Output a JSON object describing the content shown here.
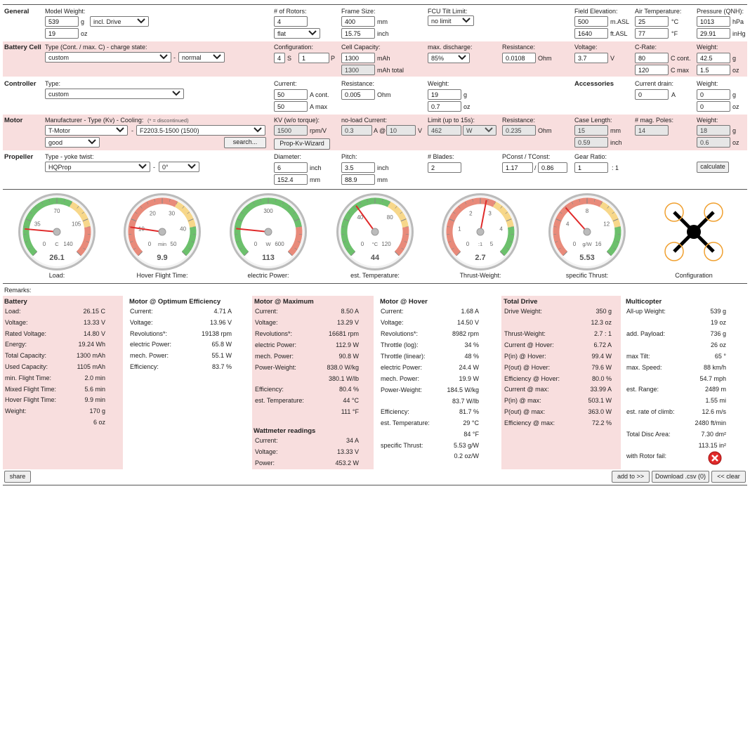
{
  "general": {
    "section": "General",
    "model_weight_label": "Model Weight:",
    "model_weight_g": "539",
    "unit_g": "g",
    "drive_option": "incl. Drive",
    "model_weight_oz": "19",
    "unit_oz": "oz",
    "rotors_label": "# of Rotors:",
    "rotors": "4",
    "rotor_layout": "flat",
    "frame_label": "Frame Size:",
    "frame_mm": "400",
    "unit_mm": "mm",
    "frame_inch": "15.75",
    "unit_inch": "inch",
    "fcu_label": "FCU Tilt Limit:",
    "fcu_value": "no limit",
    "elev_label": "Field Elevation:",
    "elev_m": "500",
    "elev_m_unit": "m.ASL",
    "elev_ft": "1640",
    "elev_ft_unit": "ft.ASL",
    "air_label": "Air Temperature:",
    "air_c": "25",
    "air_c_unit": "°C",
    "air_f": "77",
    "air_f_unit": "°F",
    "qnh_label": "Pressure (QNH):",
    "qnh_hpa": "1013",
    "qnh_hpa_unit": "hPa",
    "qnh_inhg": "29.91",
    "qnh_inhg_unit": "inHg"
  },
  "battery": {
    "section": "Battery Cell",
    "type_label": "Type (Cont. / max. C) - charge state:",
    "type": "custom",
    "dash": "-",
    "state": "normal",
    "config_label": "Configuration:",
    "s": "4",
    "s_unit": "S",
    "p": "1",
    "p_unit": "P",
    "cap_label": "Cell Capacity:",
    "cap": "1300",
    "cap_unit": "mAh",
    "cap_total": "1300",
    "cap_total_unit": "mAh total",
    "disch_label": "max. discharge:",
    "disch": "85%",
    "res_label": "Resistance:",
    "res": "0.0108",
    "res_unit": "Ohm",
    "volt_label": "Voltage:",
    "volt": "3.7",
    "volt_unit": "V",
    "crate_label": "C-Rate:",
    "c_cont": "80",
    "c_cont_unit": "C cont.",
    "c_max": "120",
    "c_max_unit": "C max",
    "w_label": "Weight:",
    "w_g": "42.5",
    "w_g_unit": "g",
    "w_oz": "1.5",
    "w_oz_unit": "oz"
  },
  "controller": {
    "section": "Controller",
    "type_label": "Type:",
    "type": "custom",
    "current_label": "Current:",
    "cont": "50",
    "cont_unit": "A cont.",
    "max": "50",
    "max_unit": "A max",
    "res_label": "Resistance:",
    "res": "0.005",
    "res_unit": "Ohm",
    "w_label": "Weight:",
    "w_g": "19",
    "w_g_unit": "g",
    "w_oz": "0.7",
    "w_oz_unit": "oz",
    "acc_label": "Accessories",
    "drain_label": "Current drain:",
    "drain": "0",
    "drain_unit": "A",
    "acc_w_label": "Weight:",
    "acc_w_g": "0",
    "acc_w_g_unit": "g",
    "acc_w_oz": "0",
    "acc_w_oz_unit": "oz"
  },
  "motor": {
    "section": "Motor",
    "mfr_label": "Manufacturer - Type (Kv) - Cooling:",
    "disc_note": "(* = discontinued)",
    "mfr": "T-Motor",
    "dash": "-",
    "model": "F2203.5-1500 (1500)",
    "cooling": "good",
    "search": "search...",
    "kv_label": "KV (w/o torque):",
    "kv": "1500",
    "kv_unit": "rpm/V",
    "wizard": "Prop-Kv-Wizard",
    "noload_label": "no-load Current:",
    "noload": "0.3",
    "noload_at": "A @",
    "noload_v": "10",
    "noload_v_unit": "V",
    "limit_label": "Limit (up to 15s):",
    "limit": "462",
    "limit_unit": "W",
    "res_label": "Resistance:",
    "res": "0.235",
    "res_unit": "Ohm",
    "case_label": "Case Length:",
    "case_mm": "15",
    "case_mm_unit": "mm",
    "case_inch": "0.59",
    "case_inch_unit": "inch",
    "poles_label": "# mag. Poles:",
    "poles": "14",
    "w_label": "Weight:",
    "w_g": "18",
    "w_g_unit": "g",
    "w_oz": "0.6",
    "w_oz_unit": "oz"
  },
  "propeller": {
    "section": "Propeller",
    "type_label": "Type - yoke twist:",
    "type": "HQProp",
    "dash": "-",
    "twist": "0°",
    "dia_label": "Diameter:",
    "dia_in": "6",
    "dia_in_unit": "inch",
    "dia_mm": "152.4",
    "dia_mm_unit": "mm",
    "pitch_label": "Pitch:",
    "pitch_in": "3.5",
    "pitch_in_unit": "inch",
    "pitch_mm": "88.9",
    "pitch_mm_unit": "mm",
    "blades_label": "# Blades:",
    "blades": "2",
    "pconst_label": "PConst / TConst:",
    "pconst": "1.17",
    "slash": "/",
    "tconst": "0.86",
    "gear_label": "Gear Ratio:",
    "gear": "1",
    "gear_unit": ": 1",
    "calculate": "calculate"
  },
  "gauges": [
    {
      "caption": "Load:",
      "value": "26.1",
      "unit": "C",
      "ticks": [
        "35",
        "70",
        "105",
        "0",
        "140"
      ],
      "needle_frac": 0.186,
      "colors": [
        "#6cc06c",
        "#f7d78a",
        "#e88a7a"
      ]
    },
    {
      "caption": "Hover Flight Time:",
      "value": "9.9",
      "unit": "min",
      "ticks": [
        "10",
        "20",
        "30",
        "40",
        "0",
        "50"
      ],
      "needle_frac": 0.198,
      "colors": [
        "#e88a7a",
        "#f7d78a",
        "#6cc06c"
      ]
    },
    {
      "caption": "electric Power:",
      "value": "113",
      "unit": "W",
      "ticks": [
        "300",
        "0",
        "600"
      ],
      "needle_frac": 0.188,
      "colors": [
        "#6cc06c",
        "#6cc06c",
        "#e88a7a"
      ]
    },
    {
      "caption": "est. Temperature:",
      "value": "44",
      "unit": "°C",
      "ticks": [
        "40",
        "80",
        "0",
        "120"
      ],
      "needle_frac": 0.367,
      "colors": [
        "#6cc06c",
        "#f7d78a",
        "#e88a7a"
      ]
    },
    {
      "caption": "Thrust-Weight:",
      "value": "2.7",
      "unit": ":1",
      "ticks": [
        "1",
        "2",
        "3",
        "4",
        "0",
        "5"
      ],
      "needle_frac": 0.54,
      "colors": [
        "#e88a7a",
        "#f7d78a",
        "#6cc06c"
      ]
    },
    {
      "caption": "specific Thrust:",
      "value": "5.53",
      "unit": "g/W",
      "ticks": [
        "4",
        "8",
        "12",
        "0",
        "16"
      ],
      "needle_frac": 0.346,
      "colors": [
        "#e88a7a",
        "#f7d78a",
        "#6cc06c"
      ]
    }
  ],
  "configuration_caption": "Configuration",
  "remarks_label": "Remarks:",
  "results": {
    "battery": {
      "title": "Battery",
      "rows": [
        [
          "Load:",
          "26.15 C"
        ],
        [
          "Voltage:",
          "13.33 V"
        ],
        [
          "Rated Voltage:",
          "14.80 V"
        ],
        [
          "Energy:",
          "19.24 Wh"
        ],
        [
          "Total Capacity:",
          "1300 mAh"
        ],
        [
          "Used Capacity:",
          "1105 mAh"
        ],
        [
          "min. Flight Time:",
          "2.0 min"
        ],
        [
          "Mixed Flight Time:",
          "5.6 min"
        ],
        [
          "Hover Flight Time:",
          "9.9 min"
        ],
        [
          "Weight:",
          "170 g"
        ],
        [
          "",
          "6 oz"
        ]
      ]
    },
    "opt": {
      "title": "Motor @ Optimum Efficiency",
      "rows": [
        [
          "Current:",
          "4.71 A"
        ],
        [
          "Voltage:",
          "13.96 V"
        ],
        [
          "Revolutions*:",
          "19138 rpm"
        ],
        [
          "electric Power:",
          "65.8 W"
        ],
        [
          "mech. Power:",
          "55.1 W"
        ],
        [
          "Efficiency:",
          "83.7 %"
        ]
      ]
    },
    "max": {
      "title": "Motor @ Maximum",
      "rows": [
        [
          "Current:",
          "8.50 A"
        ],
        [
          "Voltage:",
          "13.29 V"
        ],
        [
          "Revolutions*:",
          "16681 rpm"
        ],
        [
          "electric Power:",
          "112.9 W"
        ],
        [
          "mech. Power:",
          "90.8 W"
        ],
        [
          "Power-Weight:",
          "838.0 W/kg"
        ],
        [
          "",
          "380.1 W/lb"
        ],
        [
          "Efficiency:",
          "80.4 %"
        ],
        [
          "est. Temperature:",
          "44 °C"
        ],
        [
          "",
          "111 °F"
        ]
      ],
      "watt_title": "Wattmeter readings",
      "watt_rows": [
        [
          "Current:",
          "34 A"
        ],
        [
          "Voltage:",
          "13.33 V"
        ],
        [
          "Power:",
          "453.2 W"
        ]
      ]
    },
    "hover": {
      "title": "Motor @ Hover",
      "rows": [
        [
          "Current:",
          "1.68 A"
        ],
        [
          "Voltage:",
          "14.50 V"
        ],
        [
          "Revolutions*:",
          "8982 rpm"
        ],
        [
          "Throttle (log):",
          "34 %"
        ],
        [
          "Throttle (linear):",
          "48 %"
        ],
        [
          "electric Power:",
          "24.4 W"
        ],
        [
          "mech. Power:",
          "19.9 W"
        ],
        [
          "Power-Weight:",
          "184.5 W/kg"
        ],
        [
          "",
          "83.7 W/lb"
        ],
        [
          "Efficiency:",
          "81.7 %"
        ],
        [
          "est. Temperature:",
          "29 °C"
        ],
        [
          "",
          "84 °F"
        ],
        [
          "specific Thrust:",
          "5.53 g/W"
        ],
        [
          "",
          "0.2 oz/W"
        ]
      ]
    },
    "drive": {
      "title": "Total Drive",
      "rows": [
        [
          "Drive Weight:",
          "350 g"
        ],
        [
          "",
          "12.3 oz"
        ],
        [
          "Thrust-Weight:",
          "2.7 : 1"
        ],
        [
          "Current @ Hover:",
          "6.72 A"
        ],
        [
          "P(in) @ Hover:",
          "99.4 W"
        ],
        [
          "P(out) @ Hover:",
          "79.6 W"
        ],
        [
          "Efficiency @ Hover:",
          "80.0 %"
        ],
        [
          "Current @ max:",
          "33.99 A"
        ],
        [
          "P(in) @ max:",
          "503.1 W"
        ],
        [
          "P(out) @ max:",
          "363.0 W"
        ],
        [
          "Efficiency @ max:",
          "72.2 %"
        ]
      ]
    },
    "multi": {
      "title": "Multicopter",
      "rows": [
        [
          "All-up Weight:",
          "539 g"
        ],
        [
          "",
          "19 oz"
        ],
        [
          "add. Payload:",
          "736 g"
        ],
        [
          "",
          "26 oz"
        ],
        [
          "max Tilt:",
          "65 °"
        ],
        [
          "max. Speed:",
          "88 km/h"
        ],
        [
          "",
          "54.7 mph"
        ],
        [
          "est. Range:",
          "2489 m"
        ],
        [
          "",
          "1.55 mi"
        ],
        [
          "est. rate of climb:",
          "12.6 m/s"
        ],
        [
          "",
          "2480 ft/min"
        ],
        [
          "Total Disc Area:",
          "7.30 dm²"
        ],
        [
          "",
          "113.15 in²"
        ],
        [
          "with Rotor fail:",
          ""
        ]
      ]
    }
  },
  "buttons": {
    "share": "share",
    "add_to": "add to >>",
    "download": "Download .csv (0)",
    "clear": "<< clear"
  }
}
